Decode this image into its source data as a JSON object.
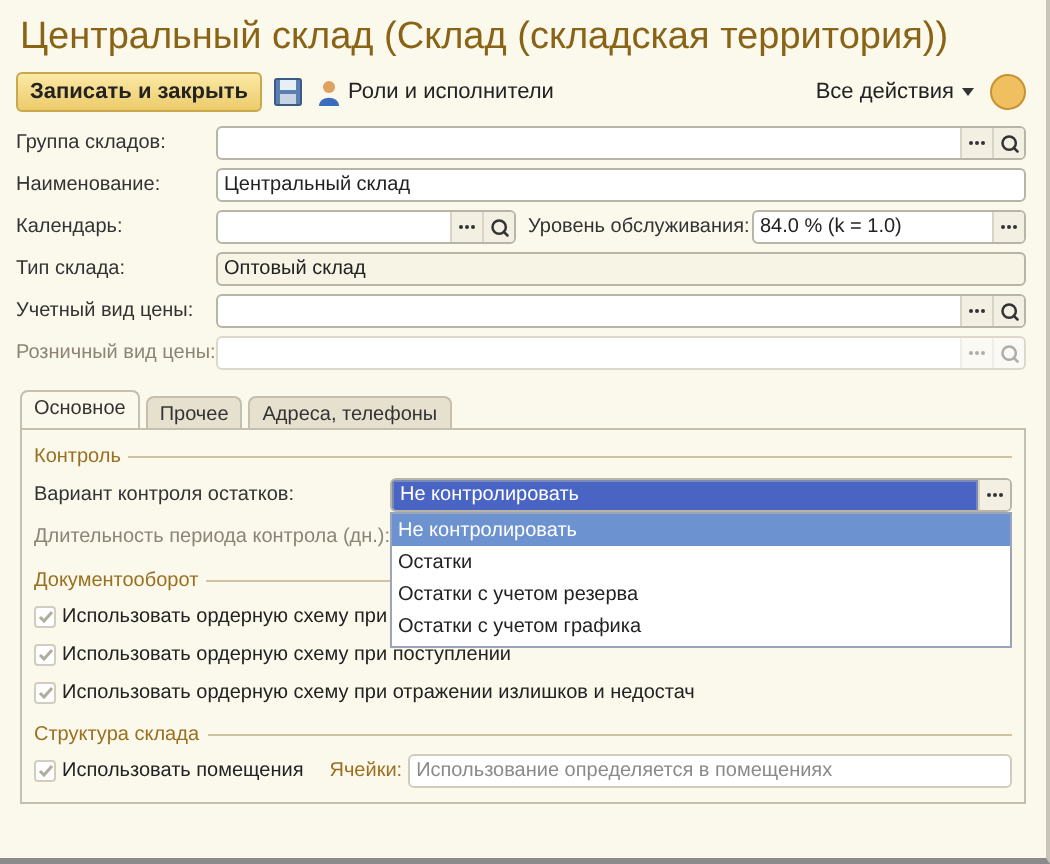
{
  "window": {
    "title": "Центральный склад (Склад (складская территория))"
  },
  "toolbar": {
    "save_close": "Записать и закрыть",
    "roles": "Роли и исполнители",
    "all_actions": "Все действия"
  },
  "rows": [
    {
      "kind": "lookup",
      "label": "Группа складов:",
      "disabled": false
    },
    {
      "kind": "text",
      "label": "Наименование:",
      "value": "Центральный склад",
      "disabled": false
    },
    {
      "kind": "split",
      "label": "Календарь:",
      "disabled": false,
      "second": {
        "label": "Уровень обслуживания:",
        "value": "84.0 % (k = 1.0)"
      }
    },
    {
      "kind": "readonly",
      "label": "Тип склада:",
      "value": "Оптовый склад",
      "disabled": false
    },
    {
      "kind": "lookup",
      "label": "Учетный вид цены:",
      "disabled": false
    },
    {
      "kind": "lookup",
      "label": "Розничный вид цены:",
      "disabled": true
    }
  ],
  "tabs": [
    {
      "label": "Основное",
      "selected": true
    },
    {
      "label": "Прочее",
      "selected": false
    },
    {
      "label": "Адреса, телефоны",
      "selected": false
    }
  ],
  "control": {
    "title": "Контроль",
    "variant_label": "Вариант контроля остатков:",
    "variant_value": "Не контролировать",
    "options": [
      {
        "label": "Не контролировать",
        "selected": true
      },
      {
        "label": "Остатки",
        "selected": false
      },
      {
        "label": "Остатки с учетом резерва",
        "selected": false
      },
      {
        "label": "Остатки с учетом графика",
        "selected": false
      }
    ],
    "duration_label": "Длительность периода контрола (дн.):",
    "duration_disabled": true
  },
  "docflow": {
    "title": "Документооборот",
    "checks": [
      {
        "label": "Использовать ордерную схему при",
        "checked": true,
        "disabled": true
      },
      {
        "label": "Использовать ордерную схему при поступлении",
        "checked": true,
        "disabled": true
      },
      {
        "label": "Использовать ордерную схему при отражении излишков и недостач",
        "checked": true,
        "disabled": true
      }
    ]
  },
  "structure": {
    "title": "Структура склада",
    "check": {
      "label": "Использовать помещения",
      "checked": true,
      "disabled": true
    },
    "cells_label": "Ячейки:",
    "cells_placeholder": "Использование определяется в помещениях"
  }
}
